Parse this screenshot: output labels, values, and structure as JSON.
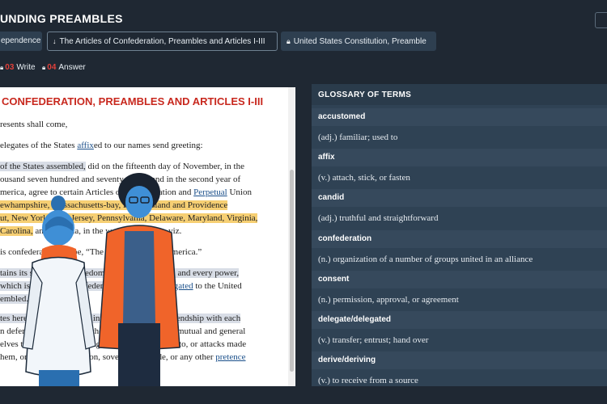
{
  "header": {
    "title": "UNDING PREAMBLES"
  },
  "tabs": [
    {
      "label": "ependence",
      "icon": "none"
    },
    {
      "label": "The Articles of Confederation, Preambles and Articles I-III",
      "icon": "arrow-down-icon",
      "active": true
    },
    {
      "label": "United States Constitution, Preamble",
      "icon": "lock-icon"
    }
  ],
  "steps": [
    {
      "num": "03",
      "label": "Write",
      "icon": "lock-icon"
    },
    {
      "num": "04",
      "label": "Answer",
      "icon": "lock-icon"
    }
  ],
  "reader": {
    "title": "CONFEDERATION, PREAMBLES AND ARTICLES I-III",
    "lines": {
      "l1": "resents shall come,",
      "l2a": "elegates of the States ",
      "l2b": "affix",
      "l2c": "ed to our names send greeting:",
      "l3a": " of the States assembled,",
      "l3b": " did on the fifteenth day of November, in the",
      "l4": "ousand seven hundred and seventy-seven, and in the second year of",
      "l5a": "merica, agree to certain Articles of Confederation and ",
      "l5b": "Perpetual",
      "l5c": " Union",
      "l6a": "ewhampshire, Massachusetts-bay, Rhode Island and Providence",
      "l7a": "ut, New York, New Jersey, Pennsylvania, Delaware, Maryland, Virginia,",
      "l8a": "Carolina,",
      "l8b": " and Georgia, in the words following, viz.",
      "l9": "is confederacy shall be, “The United States of America.”",
      "l10a": "tains its sovereignty, freedom, and independence, and every power,",
      "l11a": " which is not by this confederation expressly ",
      "l11b": "delegated",
      "l11c": " to the United",
      "l12": "embled.",
      "l13a": "tes hereby severally enter into a firm league of friendship with each",
      "l13b": "",
      "l14": "n defence, the security of their liberties, and their mutual and general",
      "l15": "elves to assist each other, against all force offered to, or attacks made",
      "l16a": "hem, on account of religion, sovereignty, trade, or any other ",
      "l16b": "pretence"
    }
  },
  "glossary": {
    "heading": "GLOSSARY OF TERMS",
    "entries": [
      {
        "term": "accustomed",
        "definition": "(adj.) familiar; used to"
      },
      {
        "term": "affix",
        "definition": "(v.) attach, stick, or fasten"
      },
      {
        "term": "candid",
        "definition": "(adj.) truthful and straightforward"
      },
      {
        "term": "confederation",
        "definition": "(n.) organization of a number of groups united in an alliance"
      },
      {
        "term": "consent",
        "definition": "(n.) permission, approval, or agreement"
      },
      {
        "term": "delegate/delegated",
        "definition": "(v.) transfer; entrust; hand over"
      },
      {
        "term": "derive/deriving",
        "definition": "(v.) to receive from a source"
      }
    ]
  },
  "colors": {
    "accent_red": "#c8281e",
    "highlight_yellow": "#f6cf73",
    "highlight_gray": "#d8dde6",
    "link_blue": "#1a4f8a",
    "panel": "#2f4254"
  }
}
